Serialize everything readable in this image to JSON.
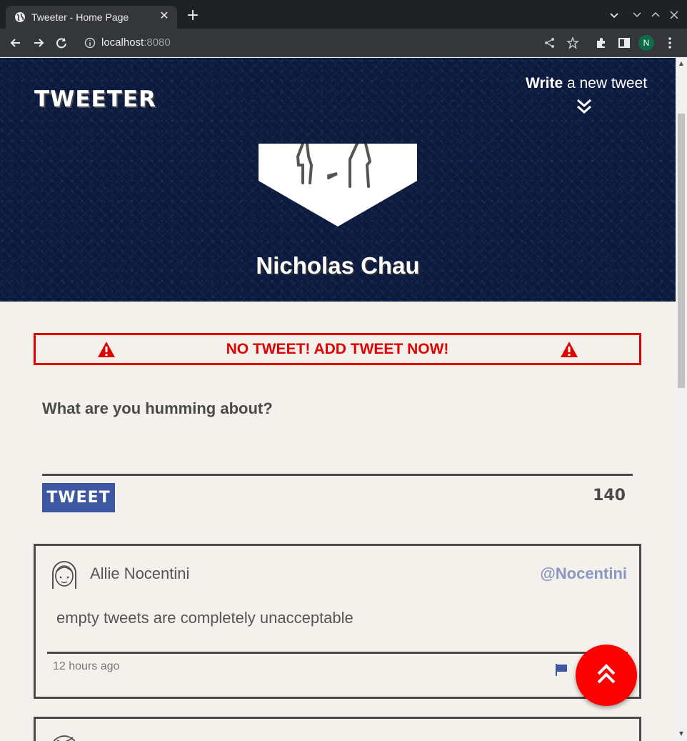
{
  "browser": {
    "tab_title": "Tweeter - Home Page",
    "url_host": "localhost",
    "url_port": ":8080",
    "profile_initial": "N"
  },
  "header": {
    "brand": "TWEETER",
    "write_bold": "Write",
    "write_rest": " a new tweet",
    "user_name": "Nicholas Chau"
  },
  "error": {
    "message": "NO TWEET! ADD TWEET NOW!"
  },
  "compose": {
    "prompt": "What are you humming about?",
    "button_label": "TWEET",
    "counter": "140"
  },
  "tweets": [
    {
      "author": "Allie Nocentini",
      "handle": "@Nocentini",
      "content": "empty tweets are completely unacceptable",
      "time": "12 hours ago"
    }
  ],
  "colors": {
    "header_bg": "#0b1a3d",
    "error": "#e00000",
    "tweet_button": "#3d57a3",
    "handle": "#8a97c0",
    "fab": "#ff0000"
  },
  "icons": [
    "globe-icon",
    "close-icon",
    "plus-icon",
    "back-icon",
    "forward-icon",
    "reload-icon",
    "info-icon",
    "share-icon",
    "star-icon",
    "extensions-icon",
    "sidepanel-icon",
    "menu-icon",
    "double-chevron-down-icon",
    "warning-icon",
    "flag-icon",
    "double-chevron-up-icon"
  ]
}
